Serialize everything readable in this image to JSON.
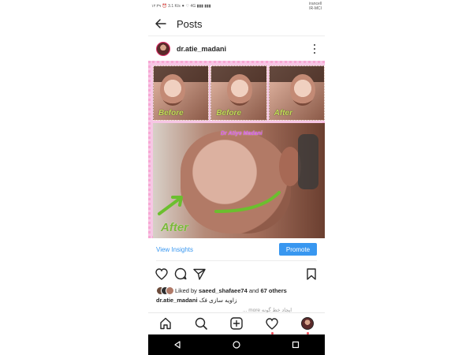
{
  "statusbar": {
    "left": "١٢:٣٩ ⏰ 3.1 K/s ⚫ ♡ 4G ▮▮▮ ▮▮▮",
    "carrier_line1": "irancell",
    "carrier_line2": "IR-MCI"
  },
  "header": {
    "title": "Posts"
  },
  "post": {
    "username": "dr.atie_madani",
    "tile_labels": [
      "Before",
      "Before",
      "After"
    ],
    "watermark": "Dr Atiye Madani",
    "after_label": "After",
    "view_insights": "View Insights",
    "promote": "Promote",
    "likes_prefix": "Liked by ",
    "liked_user": "saeed_shafaee74",
    "likes_mid": " and ",
    "likes_others": "67 others",
    "caption_user": "dr.atie_madani",
    "caption_text": "زاویه سازی فک",
    "more_line": "... more ایجاد خط گونه"
  },
  "colors": {
    "accent": "#3897f0",
    "border_dots": "#f6a7d3",
    "label_green": "#c7e05a",
    "after_green": "#7ab83a",
    "watermark": "#d04fe0",
    "notification": "#ed4956"
  },
  "icons": {
    "back": "arrow-left-icon",
    "more": "more-vertical-icon",
    "like": "heart-icon",
    "comment": "comment-icon",
    "share": "send-icon",
    "save": "bookmark-icon",
    "home": "home-icon",
    "search": "search-icon",
    "add": "add-post-icon",
    "activity": "heart-icon",
    "profile": "profile-avatar"
  }
}
